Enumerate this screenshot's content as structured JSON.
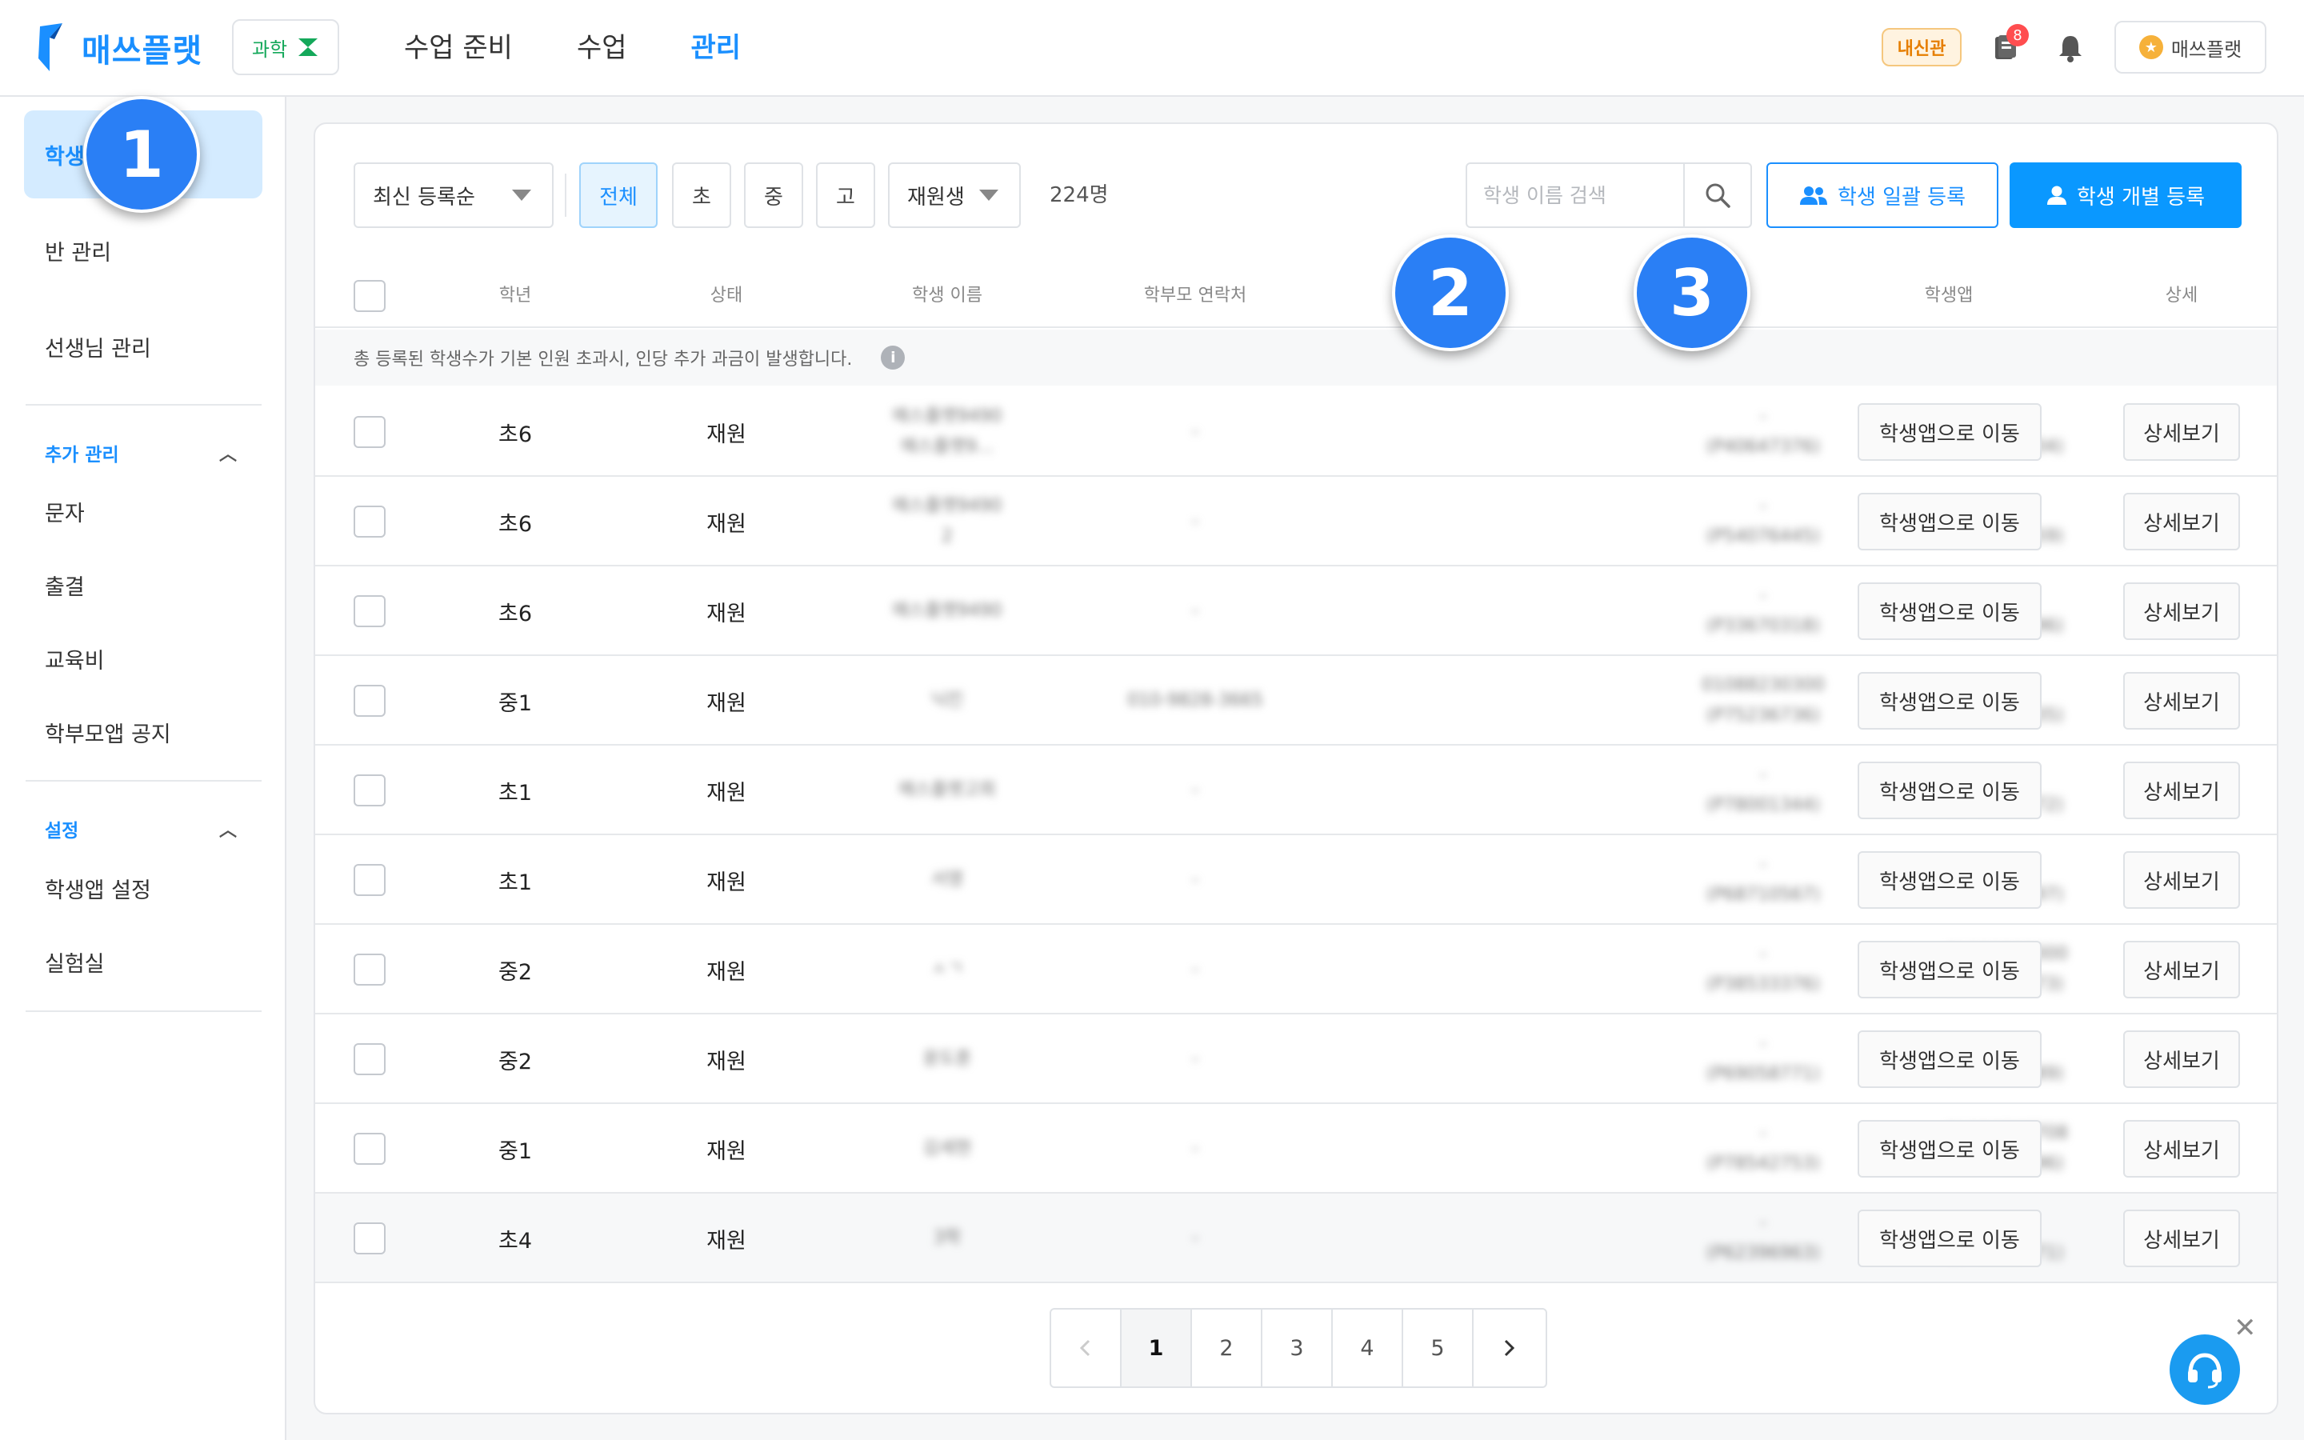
{
  "header": {
    "logo_text": "매쓰플랫",
    "subject_chip": "과학",
    "nav": [
      {
        "label": "수업 준비",
        "active": false
      },
      {
        "label": "수업",
        "active": false
      },
      {
        "label": "관리",
        "active": true
      }
    ],
    "badge_label": "내신관",
    "notification_count": "8",
    "profile_label": "매쓰플랫",
    "brand_color": "#1a8fff"
  },
  "sidebar": {
    "items": [
      {
        "label": "학생",
        "active": true
      },
      {
        "label": "반 관리"
      },
      {
        "label": "선생님 관리"
      }
    ],
    "sections": [
      {
        "title": "추가 관리",
        "items": [
          "문자",
          "출결",
          "교육비",
          "학부모앱 공지"
        ]
      },
      {
        "title": "설정",
        "items": [
          "학생앱 설정",
          "실험실"
        ]
      }
    ]
  },
  "toolbar": {
    "sort_select": "최신 등록순",
    "grade_filters": [
      {
        "label": "전체",
        "active": true
      },
      {
        "label": "초"
      },
      {
        "label": "중"
      },
      {
        "label": "고"
      }
    ],
    "status_select": "재원생",
    "count": "224명",
    "search_placeholder": "학생 이름 검색",
    "bulk_register_label": "학생 일괄 등록",
    "single_register_label": "학생 개별 등록"
  },
  "table": {
    "headers": [
      "학년",
      "상태",
      "학생 이름",
      "학부모 연락처",
      "",
      "",
      "학생앱",
      "상세"
    ],
    "notice": "총 등록된 학생수가 기본 인원 초과시, 인당 추가 과금이 발생합니다.",
    "app_button_label": "학생앱으로 이동",
    "detail_button_label": "상세보기",
    "rows": [
      {
        "grade": "초6",
        "status": "재원",
        "name": [
          "매스플랫9490",
          "매스플랫9..."
        ],
        "parent": "-",
        "c2": [
          "-",
          "(P40647376)"
        ],
        "c3": [
          "-",
          "(S97834804)"
        ]
      },
      {
        "grade": "초6",
        "status": "재원",
        "name": [
          "매스플랫9490",
          "2"
        ],
        "parent": "-",
        "c2": [
          "-",
          "(P54076445)"
        ],
        "c3": [
          "-",
          "(S86235459)"
        ]
      },
      {
        "grade": "초6",
        "status": "재원",
        "name": [
          "매스플랫9490"
        ],
        "parent": "-",
        "c2": [
          "-",
          "(P33670318)"
        ],
        "c3": [
          "-",
          "(S37388896)"
        ]
      },
      {
        "grade": "중1",
        "status": "재원",
        "name": [
          "닉킨"
        ],
        "parent": "010-9828-3665",
        "c2": [
          "01088230300",
          "(P75236736)"
        ],
        "c3": [
          "-",
          "(S71745335)"
        ]
      },
      {
        "grade": "초1",
        "status": "재원",
        "name": [
          "매스플랫고희"
        ],
        "parent": "-",
        "c2": [
          "-",
          "(P78001344)"
        ],
        "c3": [
          "-",
          "(S72794972)"
        ]
      },
      {
        "grade": "초1",
        "status": "재원",
        "name": [
          "서영"
        ],
        "parent": "-",
        "c2": [
          "-",
          "(P68710567)"
        ],
        "c3": [
          "-",
          "(S60952797)"
        ]
      },
      {
        "grade": "중2",
        "status": "재원",
        "name": [
          "ㅅㄱ"
        ],
        "parent": "-",
        "c2": [
          "-",
          "(P38533376)"
        ],
        "c3": [
          "01000000000",
          "(S74533973)"
        ]
      },
      {
        "grade": "중2",
        "status": "재원",
        "name": [
          "윤도훈"
        ],
        "parent": "-",
        "c2": [
          "-",
          "(P69058771)"
        ],
        "c3": [
          "-",
          "(S23289989)"
        ]
      },
      {
        "grade": "중1",
        "status": "재원",
        "name": [
          "김세현"
        ],
        "parent": "-",
        "c2": [
          "-",
          "(P78542753)"
        ],
        "c3": [
          "01086727708",
          "(S97702396)"
        ]
      },
      {
        "grade": "초4",
        "status": "재원",
        "name": [
          "3학"
        ],
        "parent": "-",
        "c2": [
          "-",
          "(P62396963)"
        ],
        "c3": [
          "-",
          "(S43088771)"
        ]
      }
    ]
  },
  "pagination": {
    "pages": [
      "1",
      "2",
      "3",
      "4",
      "5"
    ],
    "current": "1"
  },
  "callouts": [
    "1",
    "2",
    "3"
  ]
}
